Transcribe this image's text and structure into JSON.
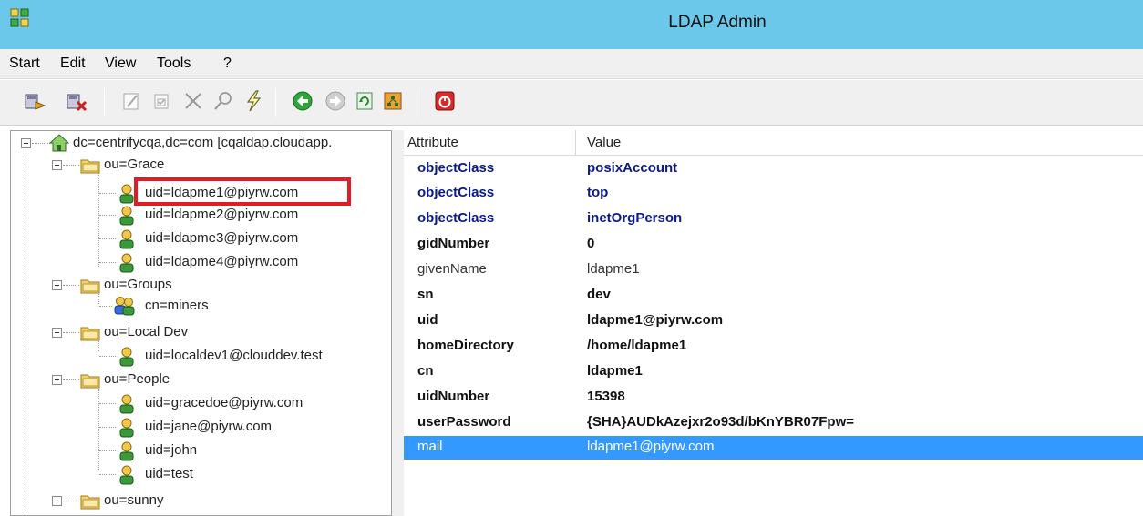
{
  "window": {
    "title": "LDAP Admin"
  },
  "menu": [
    "Start",
    "Edit",
    "View",
    "Tools",
    "?"
  ],
  "toolbar": {
    "buttons": [
      "connect-icon",
      "disconnect-icon",
      "edit-icon",
      "properties-icon",
      "delete-icon",
      "search-icon",
      "lightning-icon",
      "back-icon",
      "forward-icon",
      "refresh-icon",
      "schema-icon",
      "exit-icon"
    ]
  },
  "tree": {
    "root": "dc=centrifycqa,dc=com [cqaldap.cloudapp.",
    "groups": [
      {
        "label": "ou=Grace",
        "children": [
          "uid=ldapme1@piyrw.com",
          "uid=ldapme2@piyrw.com",
          "uid=ldapme3@piyrw.com",
          "uid=ldapme4@piyrw.com"
        ]
      },
      {
        "label": "ou=Groups",
        "children": [
          "cn=miners"
        ]
      },
      {
        "label": "ou=Local Dev",
        "children": [
          "uid=localdev1@clouddev.test"
        ]
      },
      {
        "label": "ou=People",
        "children": [
          "uid=gracedoe@piyrw.com",
          "uid=jane@piyrw.com",
          "uid=john",
          "uid=test"
        ]
      },
      {
        "label": "ou=sunny",
        "children": []
      }
    ]
  },
  "grid": {
    "headers": {
      "attribute": "Attribute",
      "value": "Value"
    },
    "rows": [
      {
        "attribute": "objectClass",
        "value": "posixAccount"
      },
      {
        "attribute": "objectClass",
        "value": "top"
      },
      {
        "attribute": "objectClass",
        "value": "inetOrgPerson"
      },
      {
        "attribute": "gidNumber",
        "value": "0"
      },
      {
        "attribute": "givenName",
        "value": "ldapme1"
      },
      {
        "attribute": "sn",
        "value": "dev"
      },
      {
        "attribute": "uid",
        "value": "ldapme1@piyrw.com"
      },
      {
        "attribute": "homeDirectory",
        "value": "/home/ldapme1"
      },
      {
        "attribute": "cn",
        "value": "ldapme1"
      },
      {
        "attribute": "uidNumber",
        "value": "15398"
      },
      {
        "attribute": "userPassword",
        "value": "{SHA}AUDkAzejxr2o93d/bKnYBR07Fpw="
      },
      {
        "attribute": "mail",
        "value": "ldapme1@piyrw.com"
      }
    ],
    "selected_index": 11
  },
  "colors": {
    "titlebar": "#6cc8ea",
    "selection": "#3399ff",
    "highlight_box": "#e01c24",
    "object_class_text": "#0a1a8c"
  }
}
